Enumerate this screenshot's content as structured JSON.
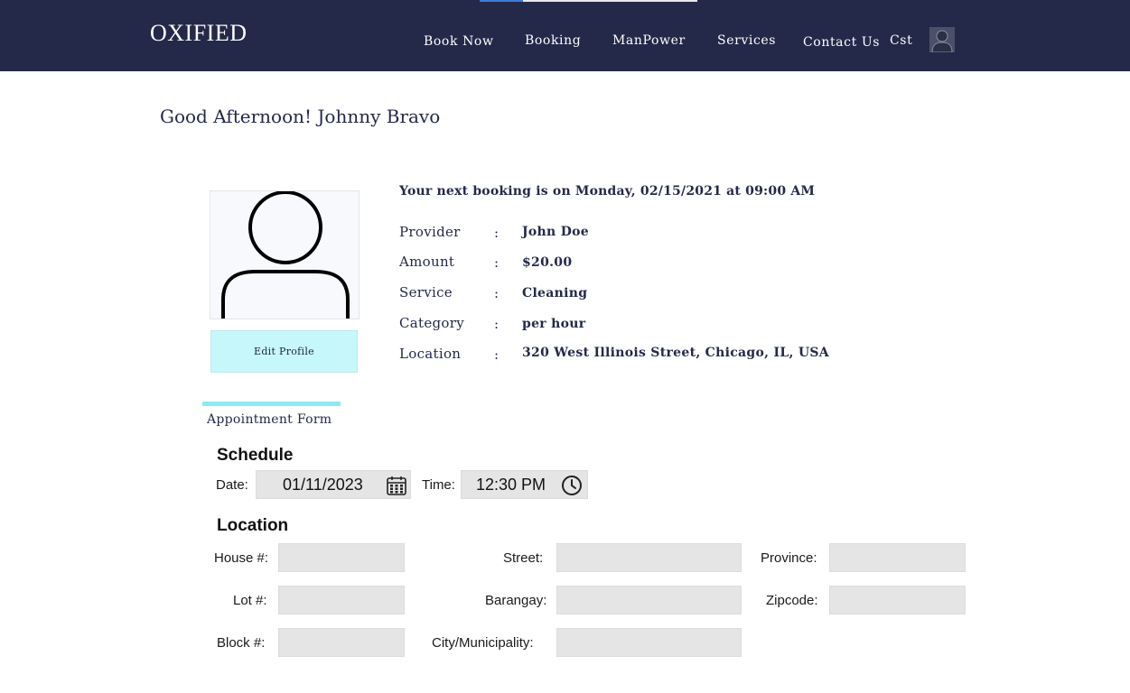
{
  "header": {
    "logo": "OXIFIED",
    "nav": [
      "Book Now",
      "Booking",
      "ManPower",
      "Services",
      "Contact Us"
    ],
    "user_label": "Cst",
    "avatar_icon": "user-avatar-icon"
  },
  "greeting": "Good Afternoon! Johnny Bravo",
  "profile": {
    "edit_button": "Edit Profile",
    "avatar_icon": "person-icon"
  },
  "booking": {
    "headline": "Your next booking is on Monday, 02/15/2021 at 09:00 AM",
    "separator": ":",
    "details": [
      {
        "label": "Provider",
        "value": "John Doe"
      },
      {
        "label": "Amount",
        "value": "$20.00"
      },
      {
        "label": "Service",
        "value": "Cleaning"
      },
      {
        "label": "Category",
        "value": "per hour"
      },
      {
        "label": "Location",
        "value": "320 West Illinois Street, Chicago, IL, USA"
      }
    ]
  },
  "appointment_form": {
    "tab_label": "Appointment Form",
    "schedule": {
      "title": "Schedule",
      "date_label": "Date:",
      "date_value": "01/11/2023",
      "time_label": "Time:",
      "time_value": "12:30 PM"
    },
    "location": {
      "title": "Location",
      "house_label": "House #:",
      "lot_label": "Lot #:",
      "block_label": "Block #:",
      "street_label": "Street:",
      "barangay_label": "Barangay:",
      "city_label": "City/Municipality:",
      "province_label": "Province:",
      "zipcode_label": "Zipcode:"
    }
  },
  "colors": {
    "navbar": "#24294a",
    "accent": "#8ceaf2",
    "edit_button": "#c6f8fb",
    "field": "#e5e5e5"
  }
}
